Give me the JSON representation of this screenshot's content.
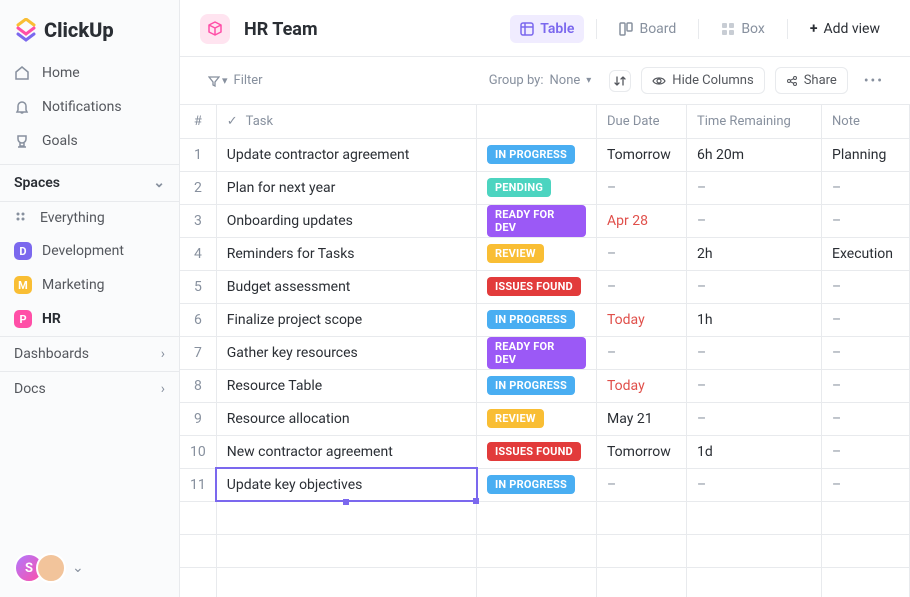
{
  "brand": "ClickUp",
  "nav": {
    "home": "Home",
    "notifications": "Notifications",
    "goals": "Goals"
  },
  "spaces_header": "Spaces",
  "everything": "Everything",
  "spaces": [
    {
      "letter": "D",
      "color": "#7b68ee",
      "label": "Development"
    },
    {
      "letter": "M",
      "color": "#f9be34",
      "label": "Marketing"
    },
    {
      "letter": "P",
      "color": "#ff4fa7",
      "label": "HR",
      "active": true
    }
  ],
  "dashboards": "Dashboards",
  "docs": "Docs",
  "header": {
    "title": "HR Team",
    "views": {
      "table": "Table",
      "board": "Board",
      "box": "Box",
      "add": "Add view"
    }
  },
  "toolbar": {
    "filter": "Filter",
    "groupby_label": "Group by:",
    "groupby_value": "None",
    "hide_columns": "Hide Columns",
    "share": "Share"
  },
  "columns": {
    "num": "#",
    "task": "Task",
    "status": "",
    "due": "Due Date",
    "time": "Time Remaining",
    "note": "Note"
  },
  "status_colors": {
    "IN PROGRESS": "#49aef2",
    "PENDING": "#4cd4c0",
    "READY FOR DEV": "#9b59f6",
    "REVIEW": "#f9be34",
    "ISSUES FOUND": "#e23b3b"
  },
  "rows": [
    {
      "n": 1,
      "task": "Update contractor agreement",
      "status": "IN PROGRESS",
      "due": "Tomorrow",
      "due_red": false,
      "time": "6h 20m",
      "note": "Planning"
    },
    {
      "n": 2,
      "task": "Plan for next year",
      "status": "PENDING",
      "due": "–",
      "time": "–",
      "note": "–"
    },
    {
      "n": 3,
      "task": "Onboarding updates",
      "status": "READY FOR DEV",
      "due": "Apr 28",
      "due_red": true,
      "time": "–",
      "note": "–"
    },
    {
      "n": 4,
      "task": "Reminders for Tasks",
      "status": "REVIEW",
      "due": "–",
      "time": "2h",
      "note": "Execution"
    },
    {
      "n": 5,
      "task": "Budget assessment",
      "status": "ISSUES FOUND",
      "due": "–",
      "time": "–",
      "note": "–"
    },
    {
      "n": 6,
      "task": "Finalize project scope",
      "status": "IN PROGRESS",
      "due": "Today",
      "due_red": true,
      "time": "1h",
      "note": "–"
    },
    {
      "n": 7,
      "task": "Gather key resources",
      "status": "READY FOR DEV",
      "due": "–",
      "time": "–",
      "note": "–"
    },
    {
      "n": 8,
      "task": "Resource Table",
      "status": "IN PROGRESS",
      "due": "Today",
      "due_red": true,
      "time": "–",
      "note": "–"
    },
    {
      "n": 9,
      "task": "Resource allocation",
      "status": "REVIEW",
      "due": "May 21",
      "time": "–",
      "note": "–"
    },
    {
      "n": 10,
      "task": "New contractor agreement",
      "status": "ISSUES FOUND",
      "due": "Tomorrow",
      "time": "1d",
      "note": "–"
    },
    {
      "n": 11,
      "task": "Update key objectives",
      "status": "IN PROGRESS",
      "due": "–",
      "time": "–",
      "note": "–",
      "editing": true
    }
  ]
}
